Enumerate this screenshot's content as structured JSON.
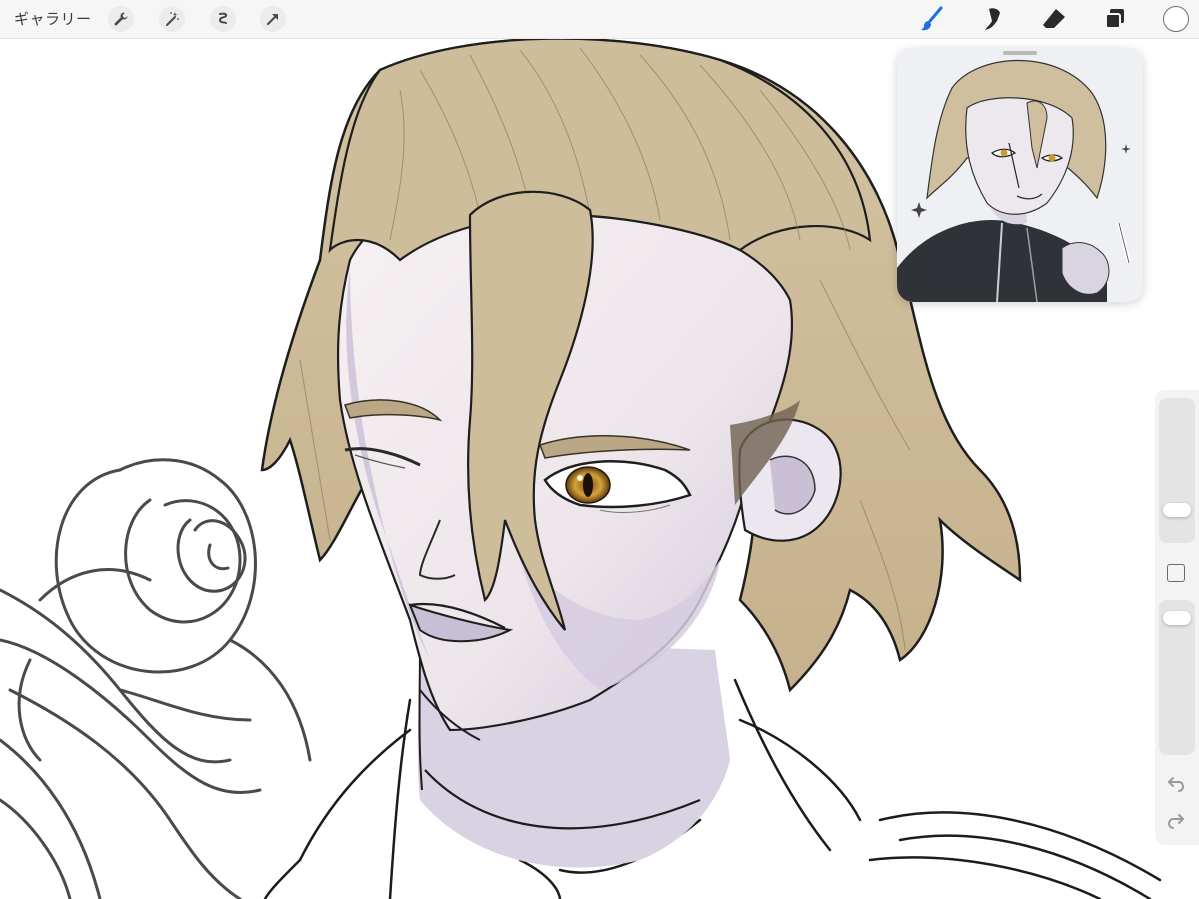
{
  "app": {
    "gallery_label": "ギャラリー"
  },
  "toolbar": {
    "left_tools": [
      "wrench-icon",
      "magic-wand-icon",
      "selection-icon",
      "transform-arrow-icon"
    ],
    "right_tools": [
      "brush-icon",
      "smudge-icon",
      "eraser-icon",
      "layers-icon"
    ],
    "active_tool": "brush-icon",
    "accent_color": "#1e6fd9",
    "current_color": "#ffffff"
  },
  "sidebar": {
    "brush_size_level": 0.48,
    "opacity_level": 0.92,
    "undo_icon": "undo-icon",
    "redo_icon": "redo-icon"
  },
  "reference": {
    "visible": true
  },
  "colors": {
    "hair": "#cdbb98",
    "skin": "#f2ecef",
    "skin_shadow": "#c9c1d6",
    "eye": "#c99a2e",
    "line": "#1f1f1f"
  }
}
